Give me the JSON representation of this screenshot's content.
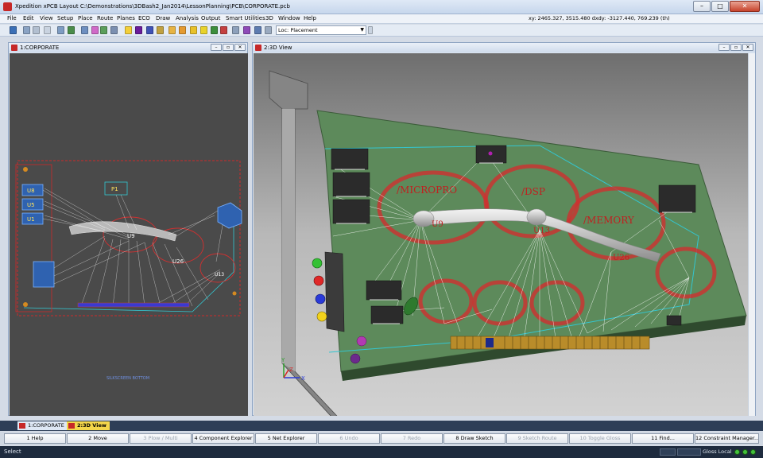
{
  "window": {
    "title": "Xpedition xPCB Layout  C:\\Demonstrations\\3DBash2_Jan2014\\LessonPlanning\\PCB\\CORPORATE.pcb"
  },
  "menu": {
    "items": [
      "File",
      "Edit",
      "View",
      "Setup",
      "Place",
      "Route",
      "Planes",
      "ECO",
      "Draw",
      "Analysis",
      "Output",
      "Smart Utilities",
      "3D",
      "Window",
      "Help"
    ]
  },
  "coord_readout": "xy: 2465.327, 3515.480  dxdy: -3127.440, 769.239 (th)",
  "toolbar": {
    "loc_value": "Loc: Placement"
  },
  "panels": {
    "left": {
      "title": "1:CORPORATE"
    },
    "right": {
      "title": "2:3D View"
    }
  },
  "pcb2d": {
    "ref_labels": [
      "U8",
      "U5",
      "U1",
      "P1",
      "U9",
      "U26",
      "U13"
    ],
    "bottom_caption": "SILKSCREEN BOTTOM"
  },
  "pcb3d": {
    "region_labels": [
      "/MICROPRO",
      "/DSP",
      "/MEMORY"
    ],
    "ref_labels": [
      "U9",
      "U13",
      "U26"
    ],
    "axis_labels": {
      "x": "X",
      "y": "Y",
      "z": "Z"
    }
  },
  "taskbar": {
    "tabs": [
      "1:CORPORATE",
      "2:3D View"
    ]
  },
  "fkeys": [
    {
      "label": "1 Help",
      "enabled": true
    },
    {
      "label": "2 Move",
      "enabled": true
    },
    {
      "label": "3 Plow / Multi",
      "enabled": false
    },
    {
      "label": "4 Component Explorer",
      "enabled": true
    },
    {
      "label": "5 Net Explorer",
      "enabled": true
    },
    {
      "label": "6 Undo",
      "enabled": false
    },
    {
      "label": "7 Redo",
      "enabled": false
    },
    {
      "label": "8 Draw Sketch",
      "enabled": true
    },
    {
      "label": "9 Sketch Route",
      "enabled": false
    },
    {
      "label": "10 Toggle Gloss",
      "enabled": false
    },
    {
      "label": "11 Find...",
      "enabled": true
    },
    {
      "label": "12 Constraint Manager...",
      "enabled": true
    }
  ],
  "status": {
    "text": "Select",
    "gloss": "Gloss Local"
  },
  "colors": {
    "pcb_2d_background": "#4a4a4a",
    "board_green": "#5c8a5c",
    "ratsnest": "#ffffff",
    "room_red": "#d03030",
    "board_outline": "#33c6d0",
    "view3d_background": "#9a9a9a"
  }
}
